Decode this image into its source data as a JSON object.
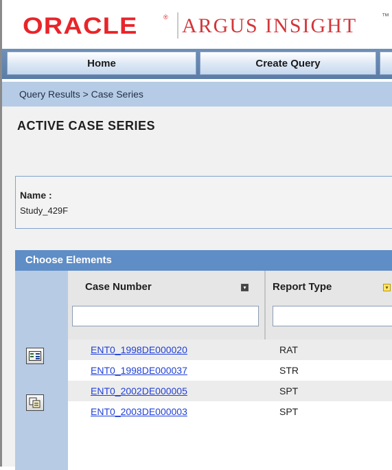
{
  "header": {
    "brand_oracle": "ORACLE",
    "registered_mark": "®",
    "product_name": "ARGUS INSIGHT",
    "trademark": "™"
  },
  "nav": {
    "tabs": [
      {
        "label": "Home"
      },
      {
        "label": "Create Query"
      }
    ]
  },
  "breadcrumb": "Query Results > Case Series",
  "page_title": "ACTIVE CASE SERIES",
  "case_series": {
    "name_label": "Name :",
    "name_value": "Study_429F"
  },
  "choose_elements": {
    "title": "Choose Elements",
    "columns": [
      {
        "header": "Case Number",
        "sort_icon": "sort-down-icon"
      },
      {
        "header": "Report Type",
        "sort_icon": "sort-down-icon"
      }
    ],
    "filters": [
      {
        "value": ""
      },
      {
        "value": ""
      }
    ],
    "rows": [
      {
        "case_number": "ENT0_1998DE000020",
        "report_type": "RAT"
      },
      {
        "case_number": "ENT0_1998DE000037",
        "report_type": "STR"
      },
      {
        "case_number": "ENT0_2002DE000005",
        "report_type": "SPT"
      },
      {
        "case_number": "ENT0_2003DE000003",
        "report_type": "SPT"
      }
    ]
  },
  "colors": {
    "brand_red": "#e8252a",
    "nav_blue": "#5f8dc6",
    "breadcrumb_bg": "#b6cce6",
    "link_blue": "#1f3fd6"
  }
}
